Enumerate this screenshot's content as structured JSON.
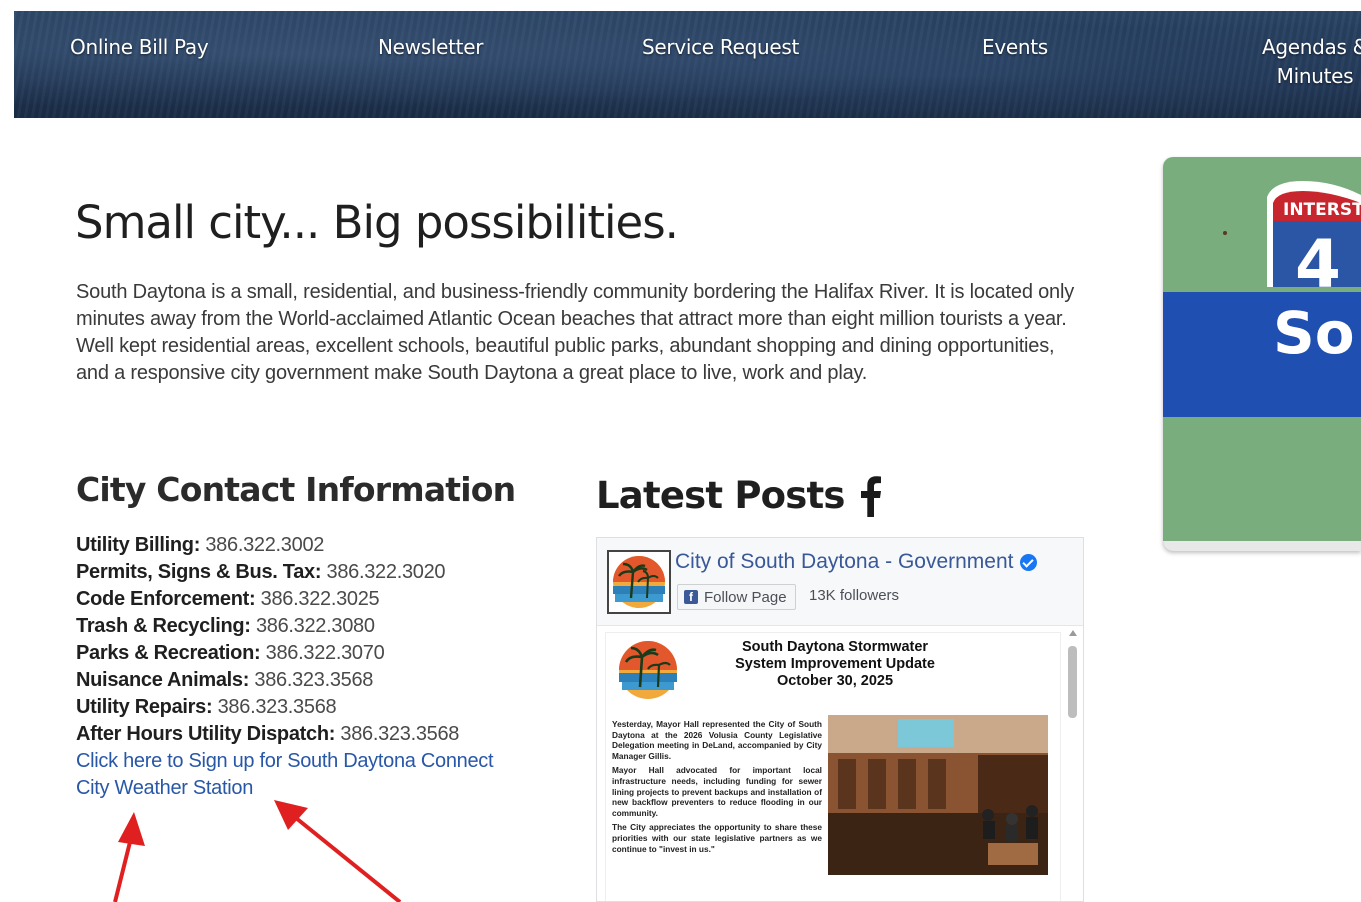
{
  "nav": {
    "items": [
      {
        "label": "Online Bill Pay"
      },
      {
        "label": "Newsletter"
      },
      {
        "label": "Service Request"
      },
      {
        "label": "Events"
      },
      {
        "label": "Agendas & Minutes"
      }
    ]
  },
  "hero": {
    "headline": "Small city... Big possibilities.",
    "intro": "South Daytona is a small, residential, and business-friendly community bordering the Halifax River. It is located only minutes away from the World-acclaimed Atlantic Ocean beaches that attract more than eight million tourists a year. Well kept residential areas, excellent schools, beautiful public parks, abundant shopping and dining opportunities, and a responsive city government make South Daytona a great place to live, work and play."
  },
  "contact": {
    "title": "City Contact Information",
    "rows": [
      {
        "label": "Utility Billing:",
        "phone": "386.322.3002"
      },
      {
        "label": "Permits, Signs & Bus. Tax:",
        "phone": "386.322.3020"
      },
      {
        "label": "Code Enforcement:",
        "phone": "386.322.3025"
      },
      {
        "label": "Trash & Recycling:",
        "phone": "386.322.3080"
      },
      {
        "label": "Parks & Recreation:",
        "phone": "386.322.3070"
      },
      {
        "label": "Nuisance Animals:",
        "phone": "386.323.3568"
      },
      {
        "label": "Utility Repairs:",
        "phone": "386.323.3568"
      },
      {
        "label": "After Hours Utility Dispatch:",
        "phone": "386.323.3568"
      }
    ],
    "links": [
      {
        "label": "Click here to Sign up for South Daytona Connect"
      },
      {
        "label": "City Weather Station"
      }
    ]
  },
  "posts": {
    "title": "Latest Posts",
    "page_name": "City of South Daytona - Government",
    "follow_label": "Follow Page",
    "followers": "13K followers",
    "post": {
      "title": "South Daytona Stormwater System Improvement Update October 30, 2025",
      "paragraphs": [
        "Yesterday, Mayor Hall represented the City of South Daytona at the 2026 Volusia County Legislative Delegation meeting in DeLand, accompanied by City Manager Gillis.",
        "Mayor Hall advocated for important local infrastructure needs, including funding for sewer lining projects to prevent backups and installation of new backflow preventers to reduce flooding in our community.",
        "The City appreciates the opportunity to share these priorities with our state legislative partners as we continue to \"invest in us.\""
      ]
    }
  },
  "banner": {
    "shield_text": "INTERSTA",
    "shield_number": "4",
    "sign_text": "So"
  },
  "colors": {
    "nav_bg": "#1f3553",
    "link": "#2857a8",
    "fb_name": "#385898",
    "arrow": "#e02020",
    "banner_green": "#79ad7e",
    "banner_blue": "#1f4fb0"
  }
}
